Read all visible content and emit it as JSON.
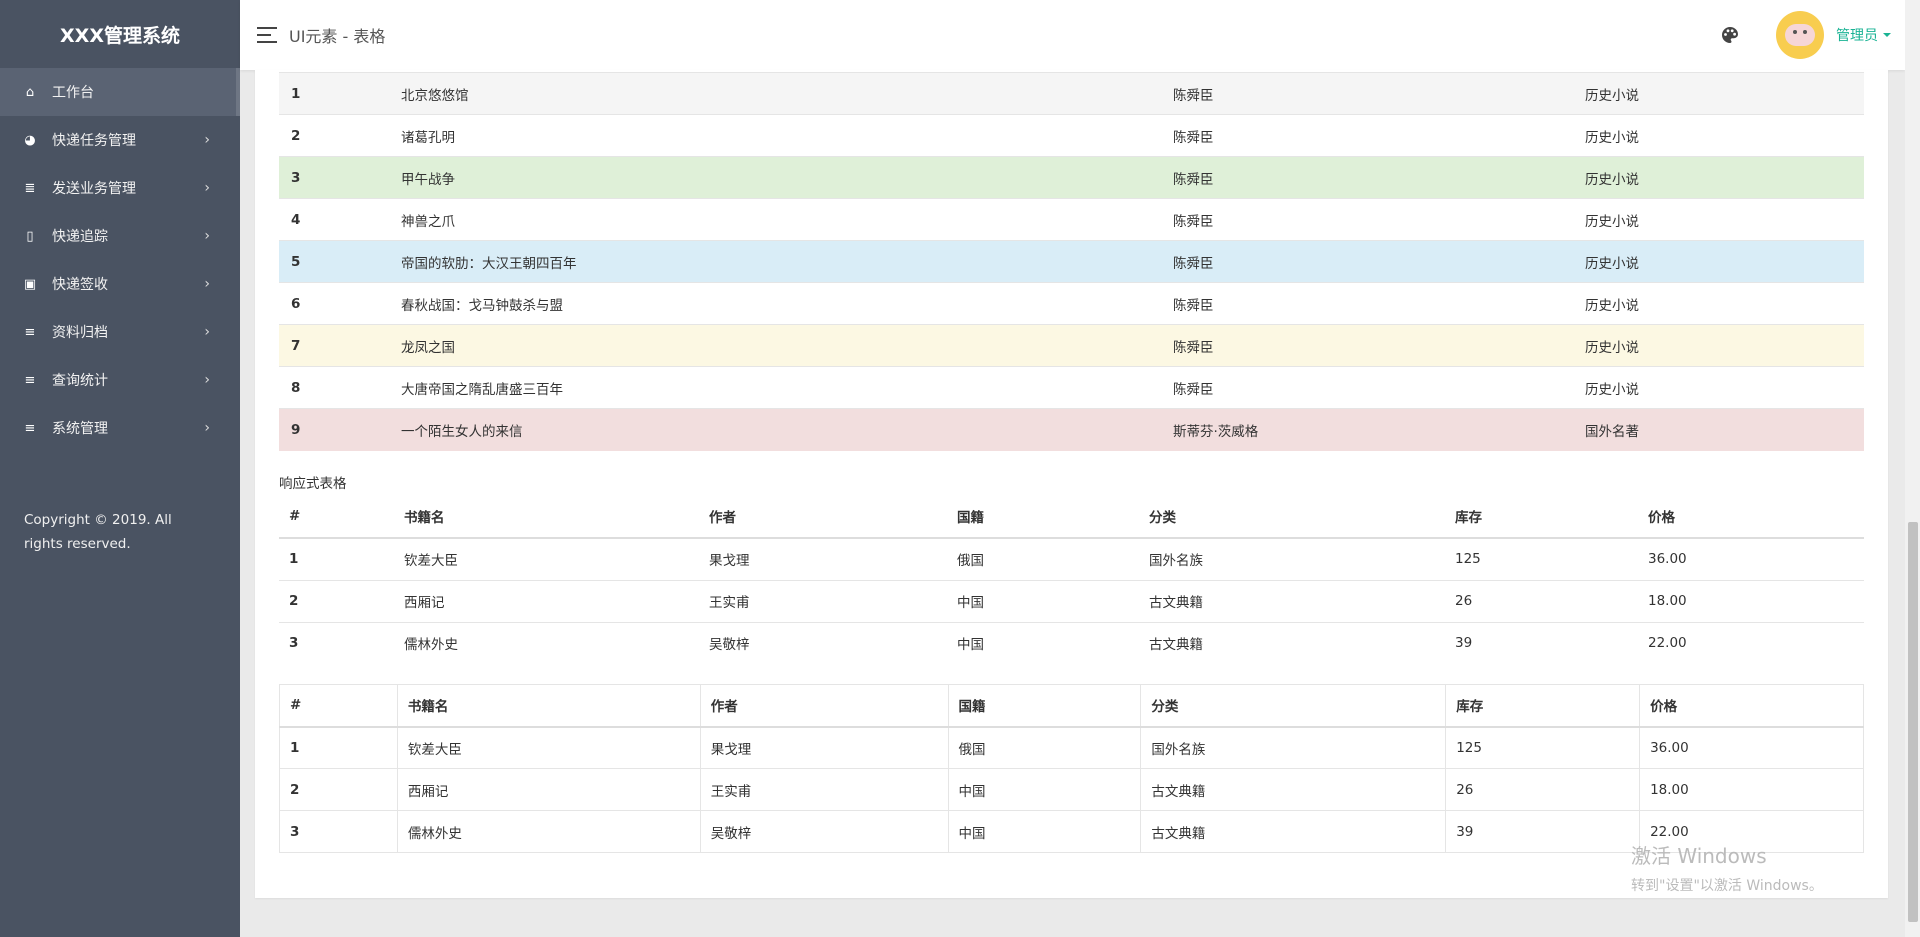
{
  "app": {
    "title": "XXX管理系统"
  },
  "sidebar": {
    "items": [
      {
        "label": "工作台",
        "icon": "home-icon",
        "active": true
      },
      {
        "label": "快递任务管理",
        "icon": "palette-icon"
      },
      {
        "label": "发送业务管理",
        "icon": "list-icon"
      },
      {
        "label": "快递追踪",
        "icon": "file-icon"
      },
      {
        "label": "快递签收",
        "icon": "js-file-icon"
      },
      {
        "label": "资料归档",
        "icon": "bars-icon"
      },
      {
        "label": "查询统计",
        "icon": "bars-icon"
      },
      {
        "label": "系统管理",
        "icon": "bars-icon"
      }
    ],
    "copyright": "Copyright © 2019. All rights reserved."
  },
  "header": {
    "breadcrumb": "UI元素 - 表格",
    "user": "管理员"
  },
  "table1": {
    "rows": [
      {
        "n": "1",
        "title": "北京悠悠馆",
        "author": "陈舜臣",
        "category": "历史小说",
        "style": "gray"
      },
      {
        "n": "2",
        "title": "诸葛孔明",
        "author": "陈舜臣",
        "category": "历史小说",
        "style": "white"
      },
      {
        "n": "3",
        "title": "甲午战争",
        "author": "陈舜臣",
        "category": "历史小说",
        "style": "green"
      },
      {
        "n": "4",
        "title": "神兽之爪",
        "author": "陈舜臣",
        "category": "历史小说",
        "style": "white"
      },
      {
        "n": "5",
        "title": "帝国的软肋：大汉王朝四百年",
        "author": "陈舜臣",
        "category": "历史小说",
        "style": "blue"
      },
      {
        "n": "6",
        "title": "春秋战国：戈马钟鼓杀与盟",
        "author": "陈舜臣",
        "category": "历史小说",
        "style": "white"
      },
      {
        "n": "7",
        "title": "龙凤之国",
        "author": "陈舜臣",
        "category": "历史小说",
        "style": "yellow"
      },
      {
        "n": "8",
        "title": "大唐帝国之隋乱唐盛三百年",
        "author": "陈舜臣",
        "category": "历史小说",
        "style": "white"
      },
      {
        "n": "9",
        "title": "一个陌生女人的来信",
        "author": "斯蒂芬·茨威格",
        "category": "国外名著",
        "style": "red"
      }
    ]
  },
  "section_label": "响应式表格",
  "books": {
    "headers": [
      "#",
      "书籍名",
      "作者",
      "国籍",
      "分类",
      "库存",
      "价格"
    ],
    "rows": [
      [
        "1",
        "钦差大臣",
        "果戈理",
        "俄国",
        "国外名族",
        "125",
        "36.00"
      ],
      [
        "2",
        "西厢记",
        "王实甫",
        "中国",
        "古文典籍",
        "26",
        "18.00"
      ],
      [
        "3",
        "儒林外史",
        "吴敬梓",
        "中国",
        "古文典籍",
        "39",
        "22.00"
      ]
    ]
  },
  "watermark": {
    "line1": "激活 Windows",
    "line2": "转到\"设置\"以激活 Windows。"
  },
  "colors": {
    "sidebar_bg": "#4a5362",
    "accent": "#1ab394",
    "avatar_bg": "#f8cd4f"
  }
}
